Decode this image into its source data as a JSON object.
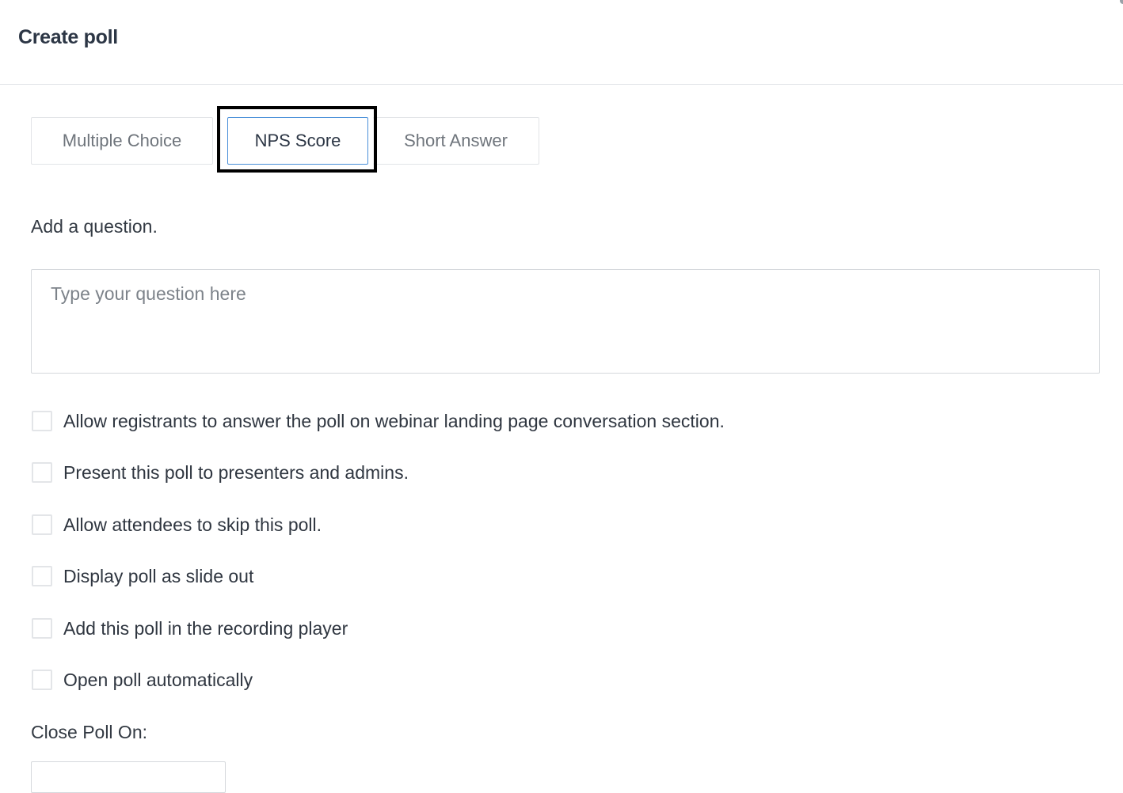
{
  "header": {
    "title": "Create poll"
  },
  "tabs": [
    {
      "label": "Multiple Choice",
      "selected": false
    },
    {
      "label": "NPS Score",
      "selected": true
    },
    {
      "label": "Short Answer",
      "selected": false
    }
  ],
  "question": {
    "label": "Add a question.",
    "placeholder": "Type your question here",
    "value": ""
  },
  "options": [
    {
      "label": "Allow registrants to answer the poll on webinar landing page conversation section.",
      "checked": false
    },
    {
      "label": "Present this poll to presenters and admins.",
      "checked": false
    },
    {
      "label": "Allow attendees to skip this poll.",
      "checked": false
    },
    {
      "label": "Display poll as slide out",
      "checked": false
    },
    {
      "label": "Add this poll in the recording player",
      "checked": false
    },
    {
      "label": "Open poll automatically",
      "checked": false
    }
  ],
  "close_poll": {
    "label": "Close Poll On:"
  },
  "colors": {
    "accent_border": "#4a90d9",
    "focus_ring": "#000000",
    "text_dark": "#2c3645"
  }
}
